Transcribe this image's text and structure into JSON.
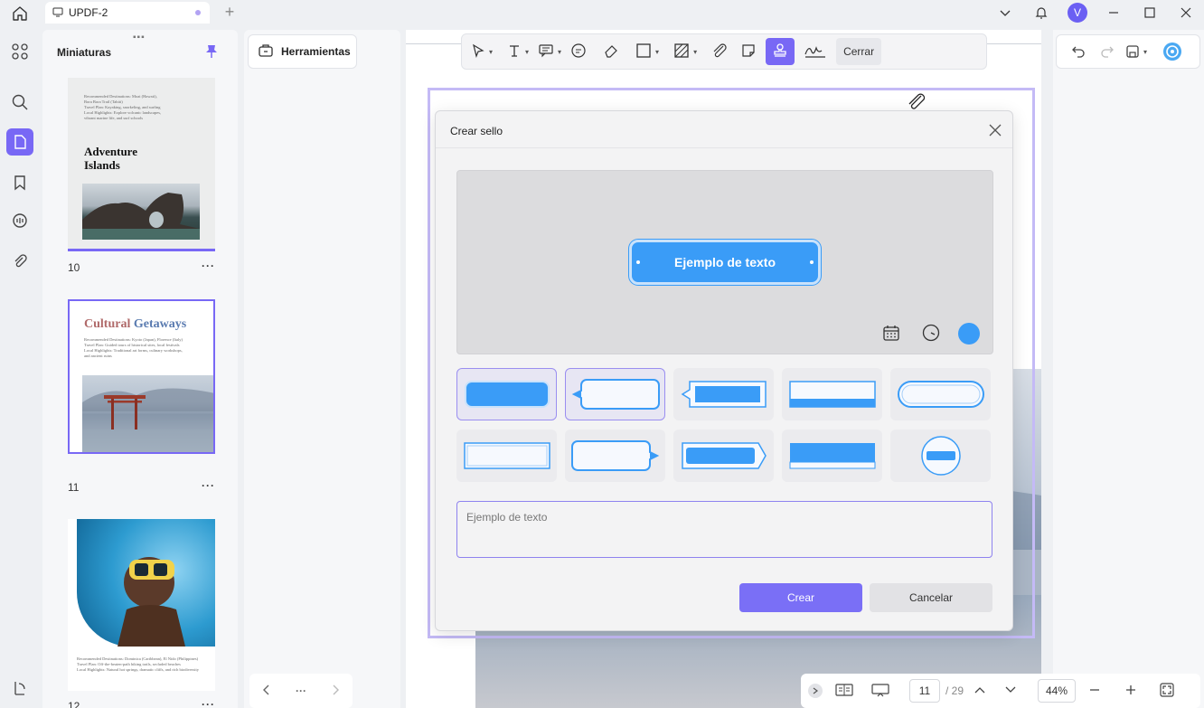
{
  "titlebar": {
    "tab_title": "UPDF-2",
    "avatar_initial": "V"
  },
  "thumbnails": {
    "title": "Miniaturas",
    "pages": [
      {
        "number": "10",
        "heading": "Adventure Islands",
        "lines": [
          "Recommended Destinations: Moai (Hawaii),",
          "Bora Bora Trail (Tahiti)",
          "Travel Plan: Kayaking, snorkeling, and surfing",
          "Local Highlights: Explore volcanic landscapes,",
          "vibrant marine life, and surf schools"
        ]
      },
      {
        "number": "11",
        "heading_a": "Cultural ",
        "heading_b": "Getaways",
        "lines": [
          "Recommended Destinations: Kyoto (Japan), Florence (Italy)",
          "Travel Plan: Guided tours of historical sites, local festivals",
          "Local Highlights: Traditional art forms, culinary workshops,",
          "and ancient ruins"
        ]
      },
      {
        "number": "12",
        "lines": [
          "Recommended Destinations: Dominica (Caribbean), El Nido (Philippines)",
          "Travel Plan: Off-the-beaten-path hiking trails, secluded beaches",
          "Local Highlights: Natural hot springs, dramatic cliffs, and rich biodiversity"
        ]
      }
    ],
    "more": "···"
  },
  "tools_panel": {
    "button_label": "Herramientas",
    "pager_dots": "···"
  },
  "annotation_toolbar": {
    "close_label": "Cerrar"
  },
  "bottom_nav": {
    "current_page": "11",
    "total_pages": "/ 29",
    "zoom": "44%"
  },
  "dialog": {
    "title": "Crear sello",
    "preview_text": "Ejemplo de texto",
    "input_value": "Ejemplo de texto",
    "create_label": "Crear",
    "cancel_label": "Cancelar",
    "stamp_color": "#3a9cf7"
  },
  "colors": {
    "accent": "#7868f5",
    "stamp_blue": "#3a9cf7"
  }
}
